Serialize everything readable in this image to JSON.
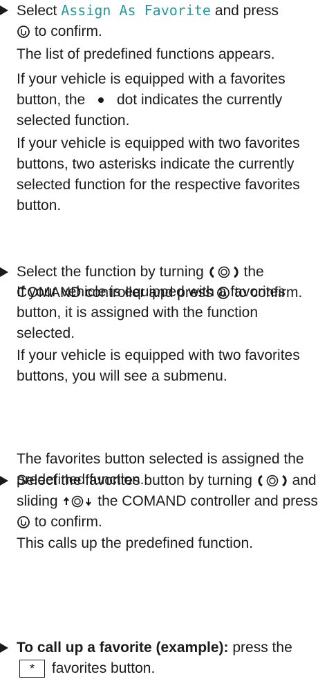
{
  "step1": {
    "before": "Select",
    "menu_item": "Assign As Favorite",
    "after_menu": "and press",
    "confirm_tail": "to confirm.",
    "result": "The list of predefined functions appears.",
    "note1_a": "If your vehicle is equipped with a favorites button, the",
    "note1_b": "dot indicates the currently selected function.",
    "note2": "If your vehicle is equipped with two favorites buttons, two asterisks indicate the currently selected function for the respective favorites button."
  },
  "step2": {
    "text_a": "Select the function by turning",
    "text_b": "the COMAND controller and press",
    "text_c": "to confirm.",
    "result": "If your vehicle is equipped with a favorites button, it is assigned with the function selected.",
    "note": "If your vehicle is equipped with two favorites buttons, you will see a submenu."
  },
  "step3": {
    "text_a": "Select the favorites button by turning",
    "text_b": "and sliding",
    "text_c": "the COMAND controller and press",
    "text_d": "to confirm.",
    "result": "The favorites button selected is assigned the predefined function."
  },
  "step4": {
    "label": "To call up a favorite (example):",
    "text_a": "press the",
    "key": "*",
    "text_b": "favorites button.",
    "result": "This calls up the predefined function."
  },
  "icons": {
    "press": "press-controller-icon",
    "turn": "turn-controller-icon",
    "slide": "slide-controller-icon",
    "dot": "dot-icon",
    "bullet": "triangle-bullet-icon"
  }
}
